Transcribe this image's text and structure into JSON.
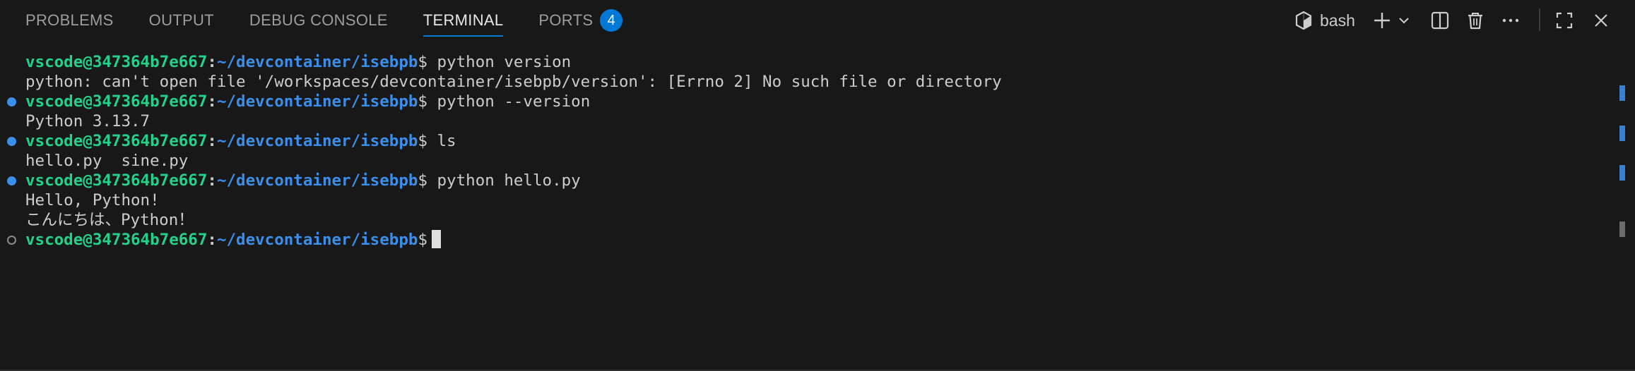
{
  "panel": {
    "tabs": [
      {
        "label": "PROBLEMS",
        "active": false
      },
      {
        "label": "OUTPUT",
        "active": false
      },
      {
        "label": "DEBUG CONSOLE",
        "active": false
      },
      {
        "label": "TERMINAL",
        "active": true
      },
      {
        "label": "PORTS",
        "active": false,
        "badge": "4"
      }
    ],
    "actions": {
      "shell_label": "bash",
      "icons": [
        "terminal-profile-icon",
        "plus-icon",
        "chevron-down-icon",
        "split-terminal-icon",
        "trash-icon",
        "more-actions-icon",
        "maximize-icon",
        "close-icon"
      ]
    }
  },
  "terminal": {
    "prompt_user": "vscode@347364b7e667",
    "prompt_sep": ":",
    "prompt_path": "~/devcontainer/isebpb",
    "prompt_dollar": "$",
    "lines": [
      {
        "type": "prompt",
        "decoration": "none",
        "command": " python version"
      },
      {
        "type": "output",
        "text": "python: can't open file '/workspaces/devcontainer/isebpb/version': [Errno 2] No such file or directory"
      },
      {
        "type": "prompt",
        "decoration": "filled",
        "command": " python --version"
      },
      {
        "type": "output",
        "text": "Python 3.13.7"
      },
      {
        "type": "prompt",
        "decoration": "filled",
        "command": " ls"
      },
      {
        "type": "output",
        "text": "hello.py  sine.py"
      },
      {
        "type": "prompt",
        "decoration": "filled",
        "command": " python hello.py"
      },
      {
        "type": "output",
        "text": "Hello, Python!"
      },
      {
        "type": "output",
        "text": "こんにちは、Python！"
      },
      {
        "type": "prompt",
        "decoration": "hollow",
        "command": " ",
        "cursor": true
      }
    ]
  },
  "colors": {
    "background": "#181818",
    "prompt_user": "#23d18b",
    "prompt_path": "#3b8eea",
    "accent": "#0078d4"
  }
}
